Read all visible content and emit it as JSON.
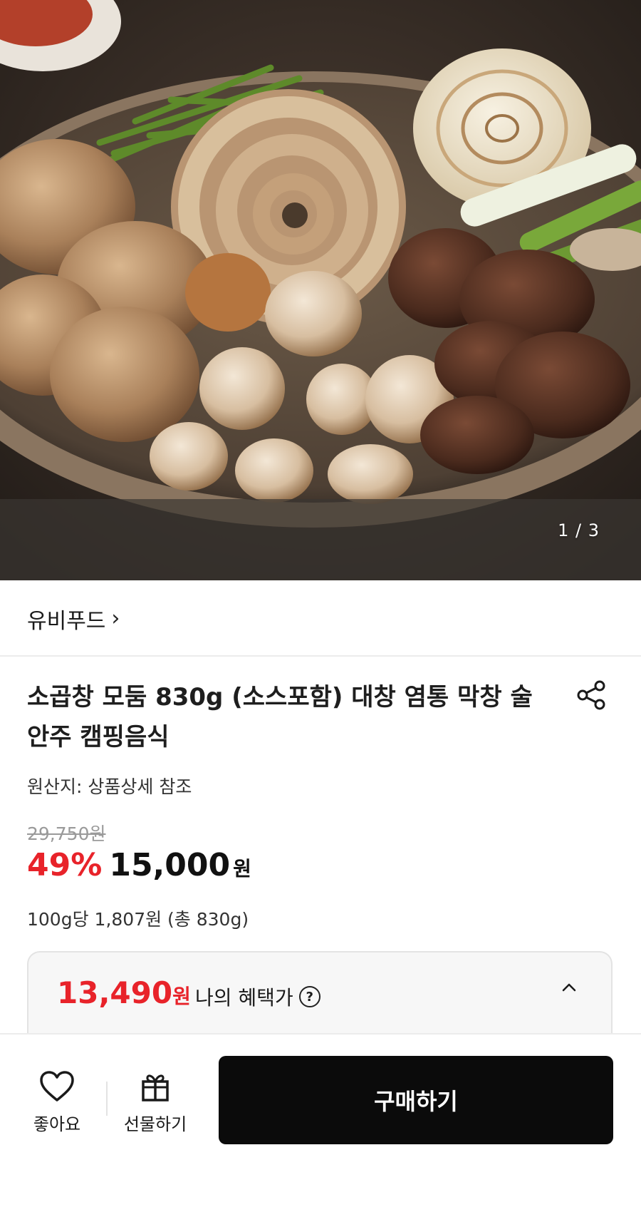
{
  "gallery": {
    "counter": "1 / 3"
  },
  "seller": {
    "name": "유비푸드",
    "chevron": "›"
  },
  "product": {
    "title": "소곱창 모둠 830g (소스포함) 대창 염통 막창 술안주 캠핑음식",
    "origin": "원산지: 상품상세 참조",
    "original_price": "29,750원",
    "discount": "49%",
    "price": "15,000",
    "price_unit": "원",
    "unit_price": "100g당 1,807원 (총 830g)"
  },
  "benefit": {
    "price": "13,490",
    "price_unit": "원",
    "label": "나의 혜택가",
    "help_glyph": "?"
  },
  "bottom_bar": {
    "like_label": "좋아요",
    "gift_label": "선물하기",
    "buy_label": "구매하기"
  },
  "icons": {
    "share": "share-icon",
    "heart": "heart-icon",
    "gift": "gift-icon",
    "collapse": "chevron-up-icon",
    "help": "question-circle-icon"
  },
  "colors": {
    "accent": "#e8232a",
    "buy_button": "#0b0b0b"
  }
}
